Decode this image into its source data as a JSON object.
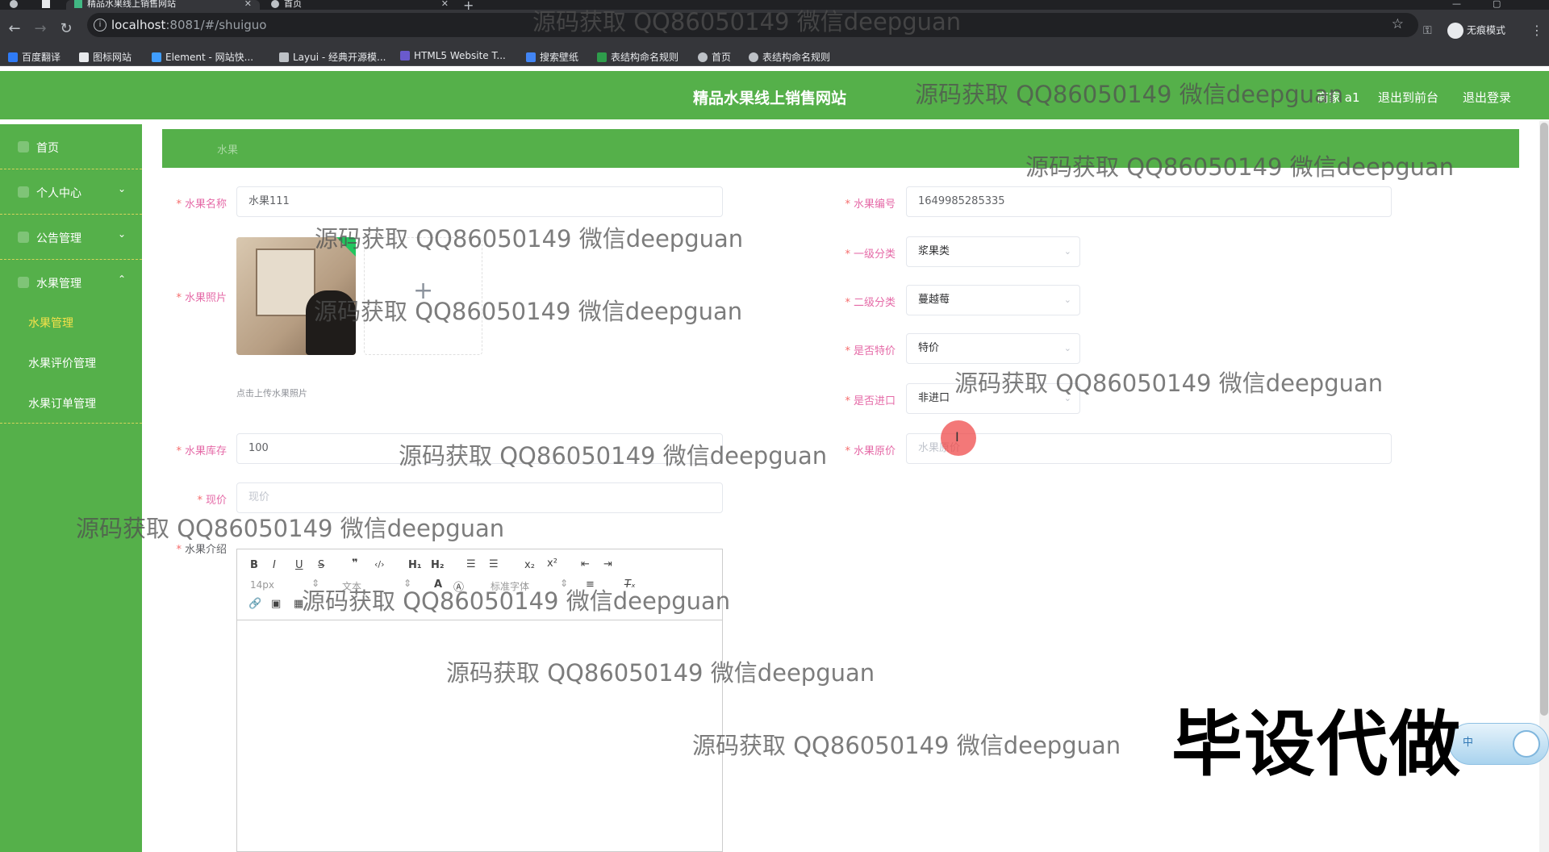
{
  "browser": {
    "tabs": [
      {
        "title": "精品水果线上销售网站",
        "active": true
      },
      {
        "title": "首页",
        "active": false
      }
    ],
    "url_host": "localhost",
    "url_rest": ":8081/#/shuiguo",
    "incognito_label": "无痕模式",
    "bookmarks": [
      "百度翻译",
      "图标网站",
      "Element - 网站快...",
      "Layui - 经典开源模...",
      "HTML5 Website T...",
      "搜索壁纸",
      "表结构命名规则",
      "首页",
      "表结构命名规则"
    ]
  },
  "header": {
    "site_title": "精品水果线上销售网站",
    "user": "商家 a1",
    "to_front": "退出到前台",
    "logout": "退出登录"
  },
  "sidebar": {
    "items": [
      {
        "label": "首页",
        "chevron": ""
      },
      {
        "label": "个人中心",
        "chevron": "⌄"
      },
      {
        "label": "公告管理",
        "chevron": "⌄"
      },
      {
        "label": "水果管理",
        "chevron": "⌃"
      }
    ],
    "sub_items": [
      {
        "label": "水果管理",
        "active": true
      },
      {
        "label": "水果评价管理",
        "active": false
      },
      {
        "label": "水果订单管理",
        "active": false
      }
    ]
  },
  "breadcrumb": "水果",
  "form": {
    "name_label": "水果名称",
    "name_value": "水果111",
    "code_label": "水果编号",
    "code_value": "1649985285335",
    "photo_label": "水果照片",
    "upload_tip": "点击上传水果照片",
    "cat1_label": "一级分类",
    "cat1_value": "浆果类",
    "cat2_label": "二级分类",
    "cat2_value": "蔓越莓",
    "special_label": "是否特价",
    "special_value": "特价",
    "import_label": "是否进口",
    "import_value": "非进口",
    "stock_label": "水果库存",
    "stock_value": "100",
    "orig_price_label": "水果原价",
    "orig_price_placeholder": "水果原价",
    "price_label": "现价",
    "price_placeholder": "现价",
    "intro_label": "水果介绍"
  },
  "editor": {
    "font_size": "14px",
    "text_type": "文本",
    "font_family": "标准字体"
  },
  "watermark": "源码获取 QQ86050149 微信deepguan",
  "stamp": "毕设代做",
  "ime_label": "中",
  "colors": {
    "brand_green": "#55b04a",
    "active_submenu": "#f5e14a",
    "label_pink": "#e56aa7",
    "required_red": "#f56c6c"
  }
}
